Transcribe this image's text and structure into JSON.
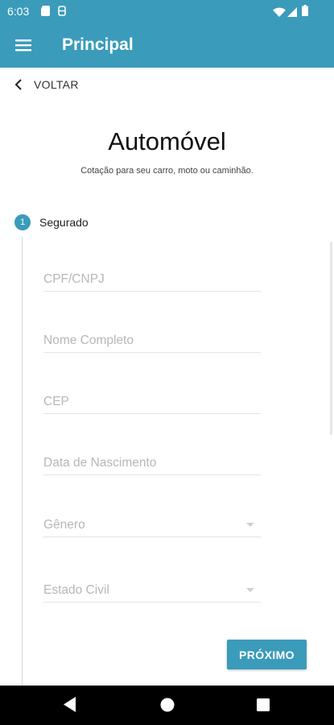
{
  "status_bar": {
    "time": "6:03",
    "icons": [
      "sd-card-icon",
      "storage-icon",
      "wifi-icon",
      "signal-icon",
      "battery-icon"
    ]
  },
  "app_bar": {
    "title": "Principal",
    "menu_icon": "hamburger-menu-icon"
  },
  "back": {
    "label": "VOLTAR"
  },
  "page": {
    "title": "Automóvel",
    "subtitle": "Cotação para seu carro, moto ou caminhão."
  },
  "step": {
    "number": "1",
    "label": "Segurado"
  },
  "form": {
    "fields": [
      {
        "placeholder": "CPF/CNPJ",
        "type": "text"
      },
      {
        "placeholder": "Nome Completo",
        "type": "text"
      },
      {
        "placeholder": "CEP",
        "type": "text"
      },
      {
        "placeholder": "Data de Nascimento",
        "type": "text"
      },
      {
        "placeholder": "Gênero",
        "type": "select"
      },
      {
        "placeholder": "Estado Civil",
        "type": "select"
      }
    ],
    "next_label": "PRÓXIMO"
  },
  "colors": {
    "primary": "#3b9bbb",
    "placeholder": "#b7b7b7",
    "nav_bar": "#000000"
  },
  "nav_bar": {
    "buttons": [
      "back-triangle-icon",
      "home-circle-icon",
      "recents-square-icon"
    ]
  }
}
